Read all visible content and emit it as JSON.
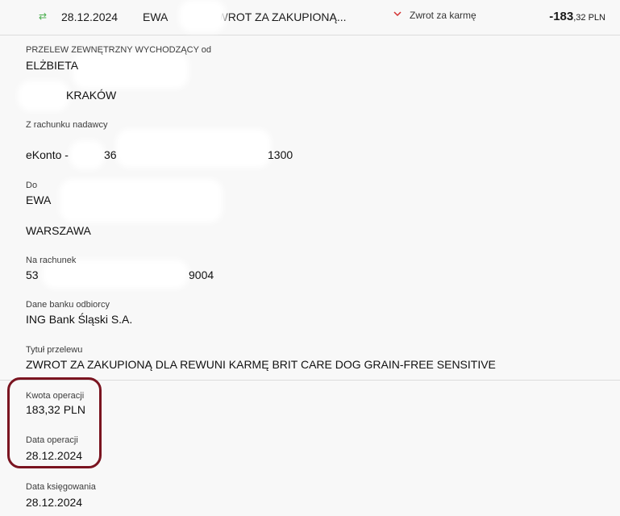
{
  "transaction": {
    "date": "28.12.2024",
    "counterparty": "EWA",
    "title_short": "ZWROT ZA ZAKUPIONĄ...",
    "category": "Zwrot za karmę",
    "amount_int": "-183",
    "amount_dec": ",32 PLN"
  },
  "details": {
    "type_label": "PRZELEW ZEWNĘTRZNY WYCHODZĄCY od",
    "sender_name": "ELŻBIETA",
    "sender_city": "KRAKÓW",
    "from_account_label": "Z rachunku nadawcy",
    "from_account_prefix": "eKonto -",
    "from_account_part": "36",
    "from_account_suffix": "1300",
    "to_label": "Do",
    "recipient_name": "EWA",
    "recipient_city": "WARSZAWA",
    "to_account_label": "Na rachunek",
    "to_account_prefix": "53",
    "to_account_suffix": "9004",
    "bank_label": "Dane banku odbiorcy",
    "bank_name": "ING Bank Śląski S.A.",
    "title_label": "Tytuł przelewu",
    "title_value": "ZWROT ZA ZAKUPIONĄ DLA REWUNI KARMĘ BRIT CARE DOG GRAIN-FREE SENSITIVE",
    "amount_label": "Kwota operacji",
    "amount_value": "183,32 PLN",
    "op_date_label": "Data operacji",
    "op_date_value": "28.12.2024",
    "post_date_label": "Data księgowania",
    "post_date_value": "28.12.2024"
  },
  "colors": {
    "positive_icon": "#4caf50",
    "category_chevron": "#d32f2f",
    "highlight": "#7a1420"
  }
}
